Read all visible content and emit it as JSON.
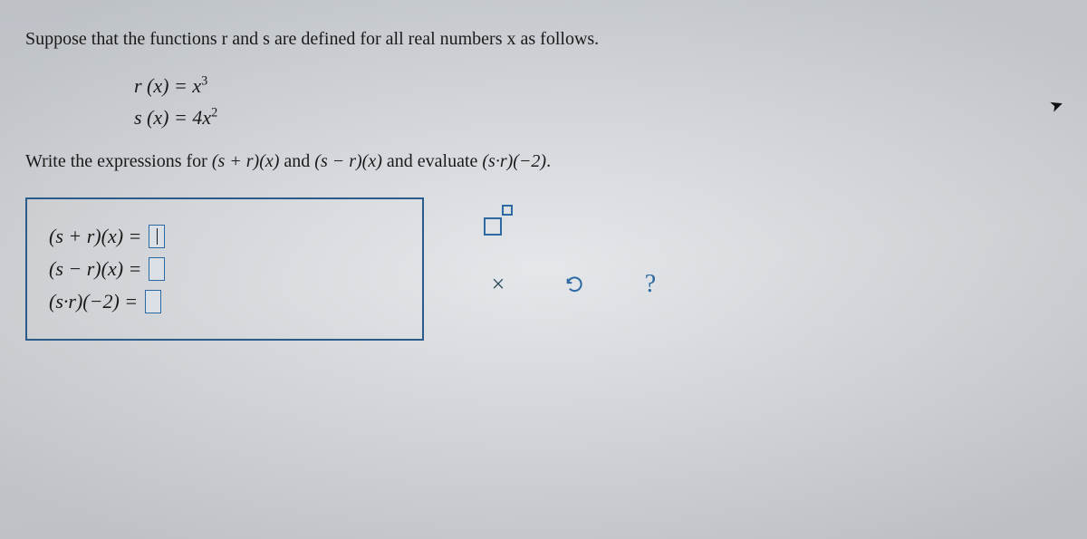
{
  "intro": "Suppose that the functions r and s are defined for all real numbers x as follows.",
  "defs": {
    "r_lhs": "r (x) = x",
    "r_exp": "3",
    "s_lhs": "s (x) = 4x",
    "s_exp": "2"
  },
  "task": {
    "pre": "Write the expressions for ",
    "e1": "(s + r)(x)",
    "mid1": " and ",
    "e2": "(s − r)(x)",
    "mid2": " and evaluate ",
    "e3": "(s·r)(−2)",
    "post": "."
  },
  "answers": {
    "line1": "(s + r)(x) = ",
    "line2": "(s − r)(x) = ",
    "line3": "(s·r)(−2) = "
  },
  "tools": {
    "exponent": "exponent-tool",
    "multiply": "×",
    "reset": "reset",
    "help": "?"
  }
}
